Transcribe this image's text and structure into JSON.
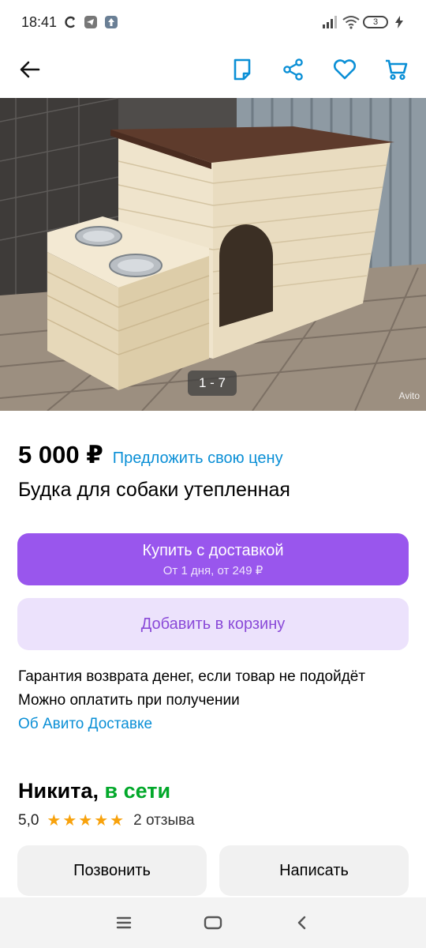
{
  "status_bar": {
    "time": "18:41",
    "battery_level": "3"
  },
  "app_bar": {
    "icons": [
      "back-arrow-icon",
      "note-icon",
      "share-icon",
      "heart-icon",
      "cart-icon"
    ]
  },
  "photo": {
    "counter": "1 - 7",
    "watermark": "Avito"
  },
  "listing": {
    "price": "5 000 ₽",
    "offer_link": "Предложить свою цену",
    "title": "Будка для собаки утепленная"
  },
  "buy_button": {
    "label": "Купить с доставкой",
    "sublabel": "От 1 дня, от 249 ₽"
  },
  "cart_button": {
    "label": "Добавить в корзину"
  },
  "info": {
    "line1": "Гарантия возврата денег, если товар не подойдёт",
    "line2": "Можно оплатить при получении",
    "link": "Об Авито Доставке"
  },
  "seller": {
    "name": "Никита,",
    "status": "в сети",
    "rating": "5,0",
    "stars": 5,
    "reviews": "2 отзыва"
  },
  "contact": {
    "call_label": "Позвонить",
    "write_label": "Написать"
  },
  "colors": {
    "accent_purple": "#9956ed",
    "cart_bg": "#ece2fc",
    "link_blue": "#0a8fd6",
    "online_green": "#02a82a",
    "star": "#f8a20c"
  }
}
